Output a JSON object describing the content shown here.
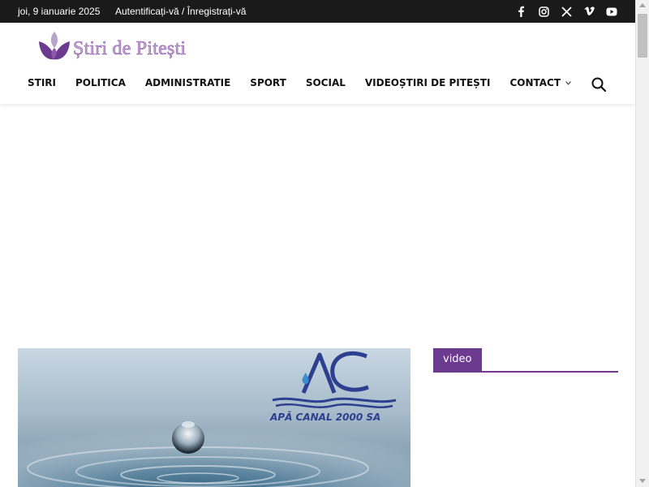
{
  "topbar": {
    "date": "joi, 9 ianuarie 2025",
    "auth": "Autentificați-vă / Înregistrați-vă",
    "socials": [
      "facebook-icon",
      "instagram-icon",
      "x-icon",
      "vimeo-icon",
      "youtube-icon"
    ]
  },
  "brand": {
    "name": "Știri de Pitești",
    "accent_color": "#6c3a8e"
  },
  "nav": {
    "items": [
      "STIRI",
      "POLITICA",
      "ADMINISTRATIE",
      "SPORT",
      "SOCIAL",
      "VIDEOȘTIRI DE PITEȘTI",
      "CONTACT"
    ]
  },
  "hero": {
    "logo_text": "APĂ CANAL 2000 SA"
  },
  "sidebar": {
    "widget_title": "video"
  }
}
